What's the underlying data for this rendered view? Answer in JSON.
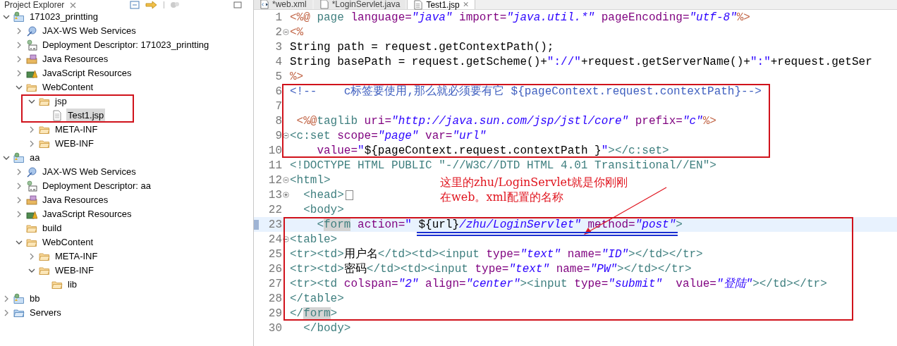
{
  "explorer": {
    "title": "Project Explorer",
    "tree": [
      {
        "label": "171023_printting",
        "kind": "project",
        "expanded": true,
        "selected": false,
        "boxed": false,
        "children": [
          {
            "label": "JAX-WS Web Services",
            "kind": "webservice",
            "expanded": false,
            "selected": false,
            "boxed": false
          },
          {
            "label": "Deployment Descriptor: 171023_printting",
            "kind": "descriptor",
            "expanded": false,
            "selected": false,
            "boxed": false
          },
          {
            "label": "Java Resources",
            "kind": "javares",
            "expanded": false,
            "selected": false,
            "boxed": false
          },
          {
            "label": "JavaScript Resources",
            "kind": "jsres",
            "expanded": false,
            "selected": false,
            "boxed": false
          },
          {
            "label": "WebContent",
            "kind": "folder",
            "expanded": true,
            "selected": false,
            "boxed": false,
            "children": [
              {
                "label": "jsp",
                "kind": "folder",
                "expanded": true,
                "selected": false,
                "boxed": true,
                "children": [
                  {
                    "label": "Test1.jsp",
                    "kind": "file",
                    "selected": true,
                    "boxed": false
                  }
                ]
              },
              {
                "label": "META-INF",
                "kind": "folder",
                "expanded": false,
                "selected": false,
                "boxed": false
              },
              {
                "label": "WEB-INF",
                "kind": "folder",
                "expanded": false,
                "selected": false,
                "boxed": false
              }
            ]
          }
        ]
      },
      {
        "label": "aa",
        "kind": "project",
        "expanded": true,
        "selected": false,
        "boxed": false,
        "children": [
          {
            "label": "JAX-WS Web Services",
            "kind": "webservice",
            "expanded": false,
            "selected": false,
            "boxed": false
          },
          {
            "label": "Deployment Descriptor: aa",
            "kind": "descriptor",
            "expanded": false,
            "selected": false,
            "boxed": false
          },
          {
            "label": "Java Resources",
            "kind": "javares",
            "expanded": false,
            "selected": false,
            "boxed": false
          },
          {
            "label": "JavaScript Resources",
            "kind": "jsres",
            "expanded": false,
            "selected": false,
            "boxed": false
          },
          {
            "label": "build",
            "kind": "folder",
            "selected": false,
            "boxed": false
          },
          {
            "label": "WebContent",
            "kind": "folder",
            "expanded": true,
            "selected": false,
            "boxed": false,
            "children": [
              {
                "label": "META-INF",
                "kind": "folder",
                "expanded": false,
                "selected": false,
                "boxed": false
              },
              {
                "label": "WEB-INF",
                "kind": "folder",
                "expanded": true,
                "selected": false,
                "boxed": false,
                "children": [
                  {
                    "label": "lib",
                    "kind": "folder",
                    "selected": false,
                    "boxed": false
                  }
                ]
              }
            ]
          }
        ]
      },
      {
        "label": "bb",
        "kind": "project",
        "expanded": false,
        "selected": false,
        "boxed": false
      },
      {
        "label": "Servers",
        "kind": "servers",
        "expanded": false,
        "selected": false,
        "boxed": false
      }
    ]
  },
  "tabs": [
    {
      "label": "*web.xml",
      "kind": "xml",
      "selected": false
    },
    {
      "label": "*LoginServlet.java",
      "kind": "java",
      "selected": false
    },
    {
      "label": "Test1.jsp",
      "kind": "jsp",
      "selected": true,
      "close": "⨯"
    }
  ],
  "editor": {
    "blocks": [
      {
        "boxed": false,
        "lines": [
          {
            "number": "1",
            "current": false,
            "tokens": [
              {
                "kind": "jsp",
                "text": "<%@"
              },
              {
                "kind": "tag",
                "text": " page"
              },
              {
                "kind": "attr",
                "text": " language="
              },
              {
                "kind": "value",
                "text": "\"java\""
              },
              {
                "kind": "attr",
                "text": " import="
              },
              {
                "kind": "value",
                "text": "\"java.util.*\""
              },
              {
                "kind": "attr",
                "text": " pageEncoding="
              },
              {
                "kind": "value",
                "text": "\"utf-8\""
              },
              {
                "kind": "jsp",
                "text": "%>"
              }
            ]
          },
          {
            "number": "2",
            "current": false,
            "expanded": true,
            "tokens": [
              {
                "kind": "jsp",
                "text": "<%"
              }
            ]
          },
          {
            "number": "3",
            "current": false,
            "tokens": [
              {
                "kind": "plain",
                "text": "String path = request.getContextPath();"
              }
            ]
          },
          {
            "number": "4",
            "current": false,
            "tokens": [
              {
                "kind": "plain",
                "text": "String basePath = request.getScheme()+"
              },
              {
                "kind": "string",
                "text": "\"://\""
              },
              {
                "kind": "plain",
                "text": "+request.getServerName()+"
              },
              {
                "kind": "string",
                "text": "\":\""
              },
              {
                "kind": "plain",
                "text": "+request.getSer"
              }
            ]
          },
          {
            "number": "5",
            "current": false,
            "tokens": [
              {
                "kind": "jsp",
                "text": "%>"
              }
            ]
          }
        ]
      },
      {
        "boxed": true,
        "lines": [
          {
            "number": "6",
            "current": false,
            "tokens": [
              {
                "kind": "comment",
                "text": "<!--    c标签要使用,那么就必须要有它 ${pageContext.request.contextPath}-->"
              }
            ]
          },
          {
            "number": "7",
            "current": false
          },
          {
            "number": "8",
            "current": false,
            "tokens": [
              {
                "kind": "jsp",
                "text": " <%@"
              },
              {
                "kind": "tag",
                "text": "taglib"
              },
              {
                "kind": "attr",
                "text": " uri="
              },
              {
                "kind": "value",
                "text": "\"http://java.sun.com/jsp/jstl/core\""
              },
              {
                "kind": "attr",
                "text": " prefix="
              },
              {
                "kind": "value",
                "text": "\"c\""
              },
              {
                "kind": "jsp",
                "text": "%>"
              }
            ]
          },
          {
            "number": "9",
            "current": false,
            "expanded": true,
            "tokens": [
              {
                "kind": "tag",
                "text": "<c:set"
              },
              {
                "kind": "attr",
                "text": " scope="
              },
              {
                "kind": "value",
                "text": "\"page\""
              },
              {
                "kind": "attr",
                "text": " var="
              },
              {
                "kind": "value",
                "text": "\"url\""
              }
            ]
          },
          {
            "number": "10",
            "current": false,
            "tokens": [
              {
                "kind": "attr",
                "text": "    value="
              },
              {
                "kind": "string",
                "text": "\""
              },
              {
                "kind": "plain",
                "text": "${pageContext.request.contextPath }"
              },
              {
                "kind": "string",
                "text": "\""
              },
              {
                "kind": "tag",
                "text": "></c:set>"
              }
            ]
          }
        ]
      },
      {
        "boxed": false,
        "lines": [
          {
            "number": "11",
            "current": false,
            "tokens": [
              {
                "kind": "tag",
                "text": "<!DOCTYPE HTML PUBLIC \"-//W3C//DTD HTML 4.01 Transitional//EN\">"
              }
            ]
          },
          {
            "number": "12",
            "current": false,
            "expanded": true,
            "tokens": [
              {
                "kind": "tag",
                "text": "<html>"
              }
            ]
          },
          {
            "number": "13",
            "current": false,
            "expanded": false,
            "tokens": [
              {
                "kind": "tag",
                "text": "  <head>"
              }
            ]
          },
          {
            "number": "22",
            "current": false,
            "tokens": [
              {
                "kind": "tag",
                "text": "  <body>"
              }
            ]
          }
        ]
      },
      {
        "boxed": true,
        "lines": [
          {
            "number": "23",
            "current": true,
            "tokens": [
              {
                "kind": "tag",
                "text": "    <"
              },
              {
                "kind": "match",
                "text": "form"
              },
              {
                "kind": "attr",
                "text": " action="
              },
              {
                "kind": "string",
                "text": "\" "
              },
              {
                "kind": "plain",
                "text": "${url}"
              },
              {
                "kind": "value",
                "text": "/zhu/LoginServlet\""
              },
              {
                "kind": "attr",
                "text": " method="
              },
              {
                "kind": "value",
                "text": "\"post\""
              },
              {
                "kind": "tag",
                "text": ">"
              }
            ]
          },
          {
            "number": "24",
            "current": false,
            "expanded": true,
            "tokens": [
              {
                "kind": "tag",
                "text": "<table>"
              }
            ]
          },
          {
            "number": "25",
            "current": false,
            "tokens": [
              {
                "kind": "tag",
                "text": "<tr><td>"
              },
              {
                "kind": "plain",
                "text": "用户名"
              },
              {
                "kind": "tag",
                "text": "</td><td><input"
              },
              {
                "kind": "attr",
                "text": " type="
              },
              {
                "kind": "value",
                "text": "\"text\""
              },
              {
                "kind": "attr",
                "text": " name="
              },
              {
                "kind": "value",
                "text": "\"ID\""
              },
              {
                "kind": "tag",
                "text": "></td></tr>"
              }
            ]
          },
          {
            "number": "26",
            "current": false,
            "tokens": [
              {
                "kind": "tag",
                "text": "<tr><td>"
              },
              {
                "kind": "plain",
                "text": "密码"
              },
              {
                "kind": "tag",
                "text": "</td><td><input"
              },
              {
                "kind": "attr",
                "text": " type="
              },
              {
                "kind": "value",
                "text": "\"text\""
              },
              {
                "kind": "attr",
                "text": " name="
              },
              {
                "kind": "value",
                "text": "\"PW\""
              },
              {
                "kind": "tag",
                "text": "></td></tr>"
              }
            ]
          },
          {
            "number": "27",
            "current": false,
            "tokens": [
              {
                "kind": "tag",
                "text": "<tr><td"
              },
              {
                "kind": "attr",
                "text": " colspan="
              },
              {
                "kind": "value",
                "text": "\"2\""
              },
              {
                "kind": "attr",
                "text": " align="
              },
              {
                "kind": "value",
                "text": "\"center\""
              },
              {
                "kind": "tag",
                "text": "><input"
              },
              {
                "kind": "attr",
                "text": " type="
              },
              {
                "kind": "value",
                "text": "\"submit\""
              },
              {
                "kind": "attr",
                "text": "  value="
              },
              {
                "kind": "value",
                "text": "\"登陆\""
              },
              {
                "kind": "tag",
                "text": "></td></tr>"
              }
            ]
          },
          {
            "number": "28",
            "current": false,
            "tokens": [
              {
                "kind": "tag",
                "text": "</table>"
              }
            ]
          },
          {
            "number": "29",
            "current": false,
            "tokens": [
              {
                "kind": "tag",
                "text": "</"
              },
              {
                "kind": "match",
                "text": "form"
              },
              {
                "kind": "tag",
                "text": ">"
              }
            ]
          }
        ]
      },
      {
        "boxed": false,
        "lines": [
          {
            "number": "30",
            "current": false,
            "tokens": [
              {
                "kind": "tag",
                "text": "  </body>"
              }
            ]
          }
        ]
      }
    ],
    "note": [
      "这里的zhu/LoginServlet就是你刚刚",
      "在web。xml配置的名称"
    ]
  }
}
